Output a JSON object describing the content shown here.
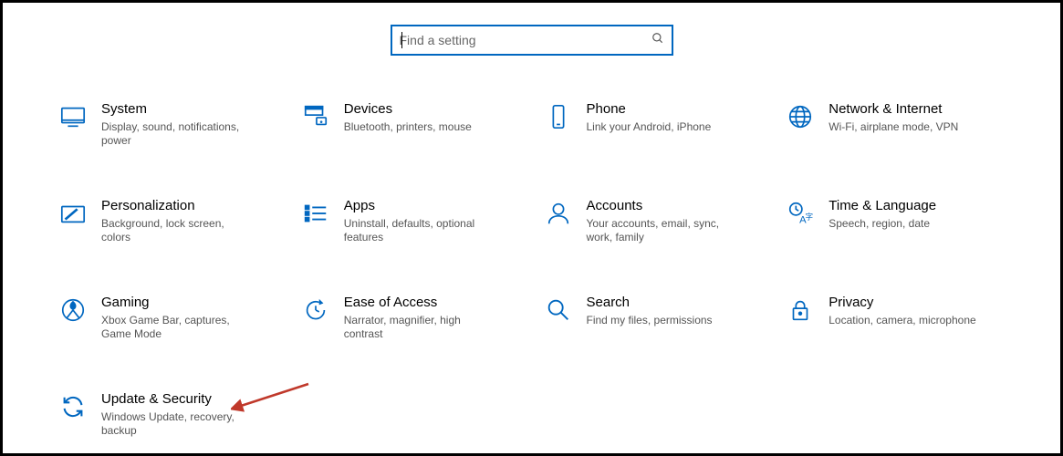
{
  "search": {
    "placeholder": "Find a setting"
  },
  "tiles": [
    {
      "title": "System",
      "desc": "Display, sound, notifications, power"
    },
    {
      "title": "Devices",
      "desc": "Bluetooth, printers, mouse"
    },
    {
      "title": "Phone",
      "desc": "Link your Android, iPhone"
    },
    {
      "title": "Network & Internet",
      "desc": "Wi-Fi, airplane mode, VPN"
    },
    {
      "title": "Personalization",
      "desc": "Background, lock screen, colors"
    },
    {
      "title": "Apps",
      "desc": "Uninstall, defaults, optional features"
    },
    {
      "title": "Accounts",
      "desc": "Your accounts, email, sync, work, family"
    },
    {
      "title": "Time & Language",
      "desc": "Speech, region, date"
    },
    {
      "title": "Gaming",
      "desc": "Xbox Game Bar, captures, Game Mode"
    },
    {
      "title": "Ease of Access",
      "desc": "Narrator, magnifier, high contrast"
    },
    {
      "title": "Search",
      "desc": "Find my files, permissions"
    },
    {
      "title": "Privacy",
      "desc": "Location, camera, microphone"
    },
    {
      "title": "Update & Security",
      "desc": "Windows Update, recovery, backup"
    }
  ],
  "accent_color": "#0067c0",
  "annotation": {
    "type": "arrow",
    "target": "update-security"
  }
}
